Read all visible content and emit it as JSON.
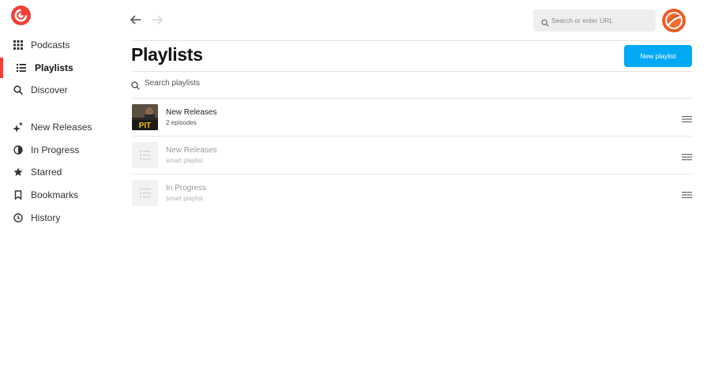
{
  "app": {
    "brand_color": "#f43e37",
    "accent_color": "#03a9f4"
  },
  "sidebar": {
    "logo_icon": "pocket-casts-logo",
    "primary": [
      {
        "label": "Podcasts",
        "icon": "grid-icon"
      },
      {
        "label": "Playlists",
        "icon": "list-icon",
        "active": true
      },
      {
        "label": "Discover",
        "icon": "search-icon"
      }
    ],
    "secondary": [
      {
        "label": "New Releases",
        "icon": "sparkle-icon"
      },
      {
        "label": "In Progress",
        "icon": "progress-circle-icon"
      },
      {
        "label": "Starred",
        "icon": "star-icon"
      },
      {
        "label": "Bookmarks",
        "icon": "bookmark-icon"
      },
      {
        "label": "History",
        "icon": "clock-icon"
      }
    ]
  },
  "header": {
    "search_placeholder": "Search or enter URL"
  },
  "main": {
    "title": "Playlists",
    "new_button_label": "New playlist",
    "search_placeholder": "Search playlists",
    "playlists": [
      {
        "name": "New Releases",
        "subtitle": "2 episodes",
        "artwork": "podcast-artwork",
        "artwork_text": "PIT"
      },
      {
        "name": "New Releases",
        "subtitle": "smart playlist",
        "artwork": "list-icon"
      },
      {
        "name": "In Progress",
        "subtitle": "smart playlist",
        "artwork": "list-icon"
      }
    ]
  }
}
